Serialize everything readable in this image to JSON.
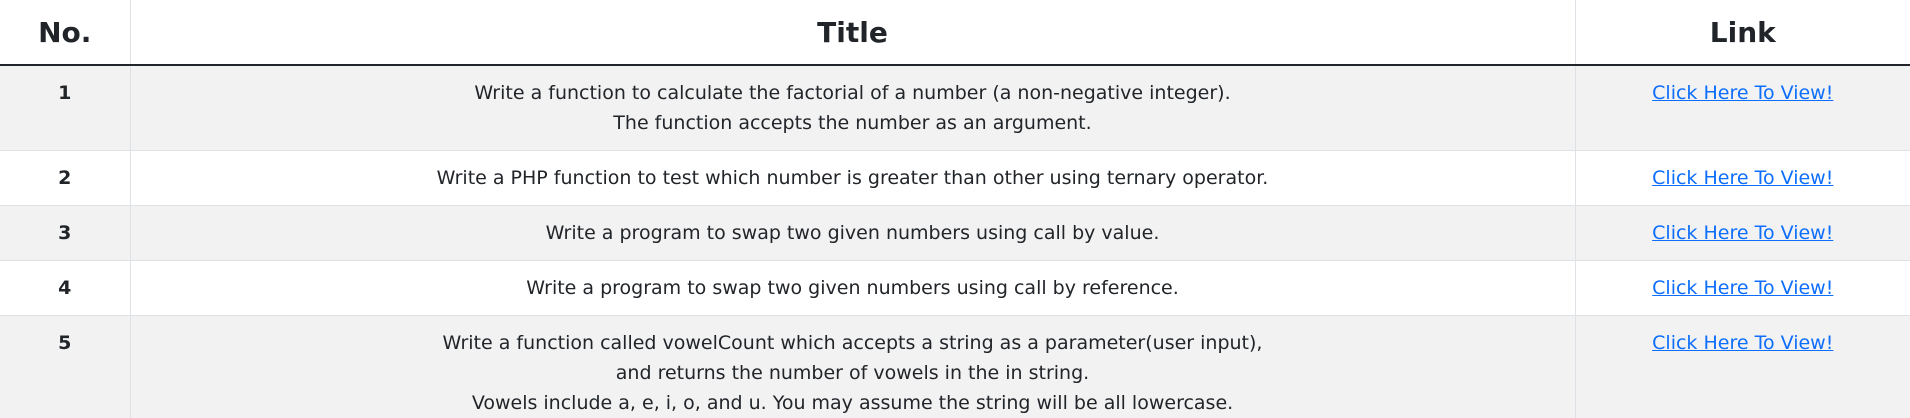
{
  "table": {
    "headers": {
      "no": "No.",
      "title": "Title",
      "link": "Link"
    },
    "rows": [
      {
        "no": "1",
        "title_lines": [
          "Write a function to calculate the factorial of a number (a non-negative integer).",
          "The function accepts the number as an argument."
        ],
        "link": "Click Here To View!"
      },
      {
        "no": "2",
        "title_lines": [
          "Write a PHP function to test which number is greater than other using ternary operator."
        ],
        "link": "Click Here To View!"
      },
      {
        "no": "3",
        "title_lines": [
          "Write a program to swap two given numbers using call by value."
        ],
        "link": "Click Here To View!"
      },
      {
        "no": "4",
        "title_lines": [
          "Write a program to swap two given numbers using call by reference."
        ],
        "link": "Click Here To View!"
      },
      {
        "no": "5",
        "title_lines": [
          "Write a function called vowelCount which accepts a string as a parameter(user input),",
          "and returns the number of vowels in the in string.",
          "Vowels include a, e, i, o, and u. You may assume the string will be all lowercase."
        ],
        "link": "Click Here To View!"
      }
    ]
  },
  "colors": {
    "stripe": "#f2f2f2",
    "link": "#0d6efd",
    "text": "#212529",
    "border": "#dee2e6"
  }
}
